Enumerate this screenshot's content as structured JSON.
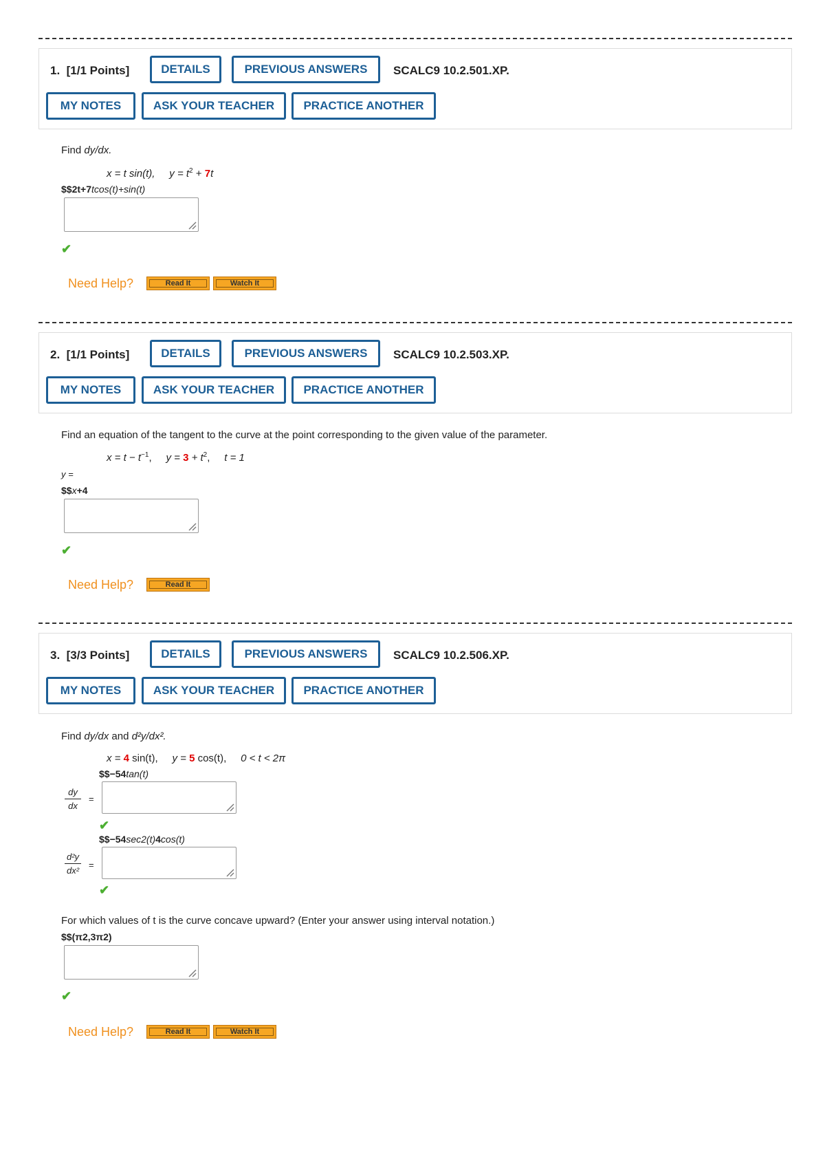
{
  "buttons": {
    "details": "DETAILS",
    "previous_answers": "PREVIOUS ANSWERS",
    "my_notes": "MY NOTES",
    "ask_teacher": "ASK YOUR TEACHER",
    "practice_another": "PRACTICE ANOTHER"
  },
  "help": {
    "need_help": "Need Help?",
    "read_it": "Read It",
    "watch_it": "Watch It"
  },
  "q1": {
    "num": "1.",
    "points": "[1/1 Points]",
    "code": "SCALC9 10.2.501.XP.",
    "prompt_find": "Find ",
    "prompt_var": "dy/dx.",
    "eq_x": "x = t sin(t),",
    "eq_y_pre": "y = t",
    "eq_y_sup": "2",
    "eq_y_plus": " + ",
    "eq_y_red": "7",
    "eq_y_post": "t",
    "answer_pre": "$$2t+7",
    "answer_it": "tcos(t)+sin(t)"
  },
  "q2": {
    "num": "2.",
    "points": "[1/1 Points]",
    "code": "SCALC9 10.2.503.XP.",
    "prompt": "Find an equation of the tangent to the curve at the point corresponding to the given value of the parameter.",
    "eq_x_pre": "x = t − t",
    "eq_x_sup": "−1",
    "eq_y_pre": "y = ",
    "eq_y_red": "3",
    "eq_y_post": " + t",
    "eq_y_sup": "2",
    "eq_t": "t = 1",
    "y_label": "y =",
    "answer_pre": "$$",
    "answer_it": "x",
    "answer_post": "+4"
  },
  "q3": {
    "num": "3.",
    "points": "[3/3 Points]",
    "code": "SCALC9 10.2.506.XP.",
    "prompt_find": "Find ",
    "prompt_a": "dy/dx",
    "prompt_and": " and ",
    "prompt_b": "d²y/dx².",
    "eq_x_pre": "x = ",
    "eq_x_red": "4",
    "eq_x_post": " sin(t),",
    "eq_y_pre": "y = ",
    "eq_y_red": "5",
    "eq_y_post": " cos(t),",
    "eq_range": "0 < t < 2π",
    "ans1_pre": "$$−54",
    "ans1_it": "tan(t)",
    "dydx_num": "dy",
    "dydx_den": "dx",
    "ans2_pre": "$$−54",
    "ans2_it": "sec2(t)",
    "ans2_mid": "4",
    "ans2_it2": "cos(t)",
    "d2_num": "d²y",
    "d2_den": "dx²",
    "equals": "=",
    "concave_prompt": "For which values of t is the curve concave upward? (Enter your answer using interval notation.)",
    "ans3": "$$(π2,3π2)"
  }
}
